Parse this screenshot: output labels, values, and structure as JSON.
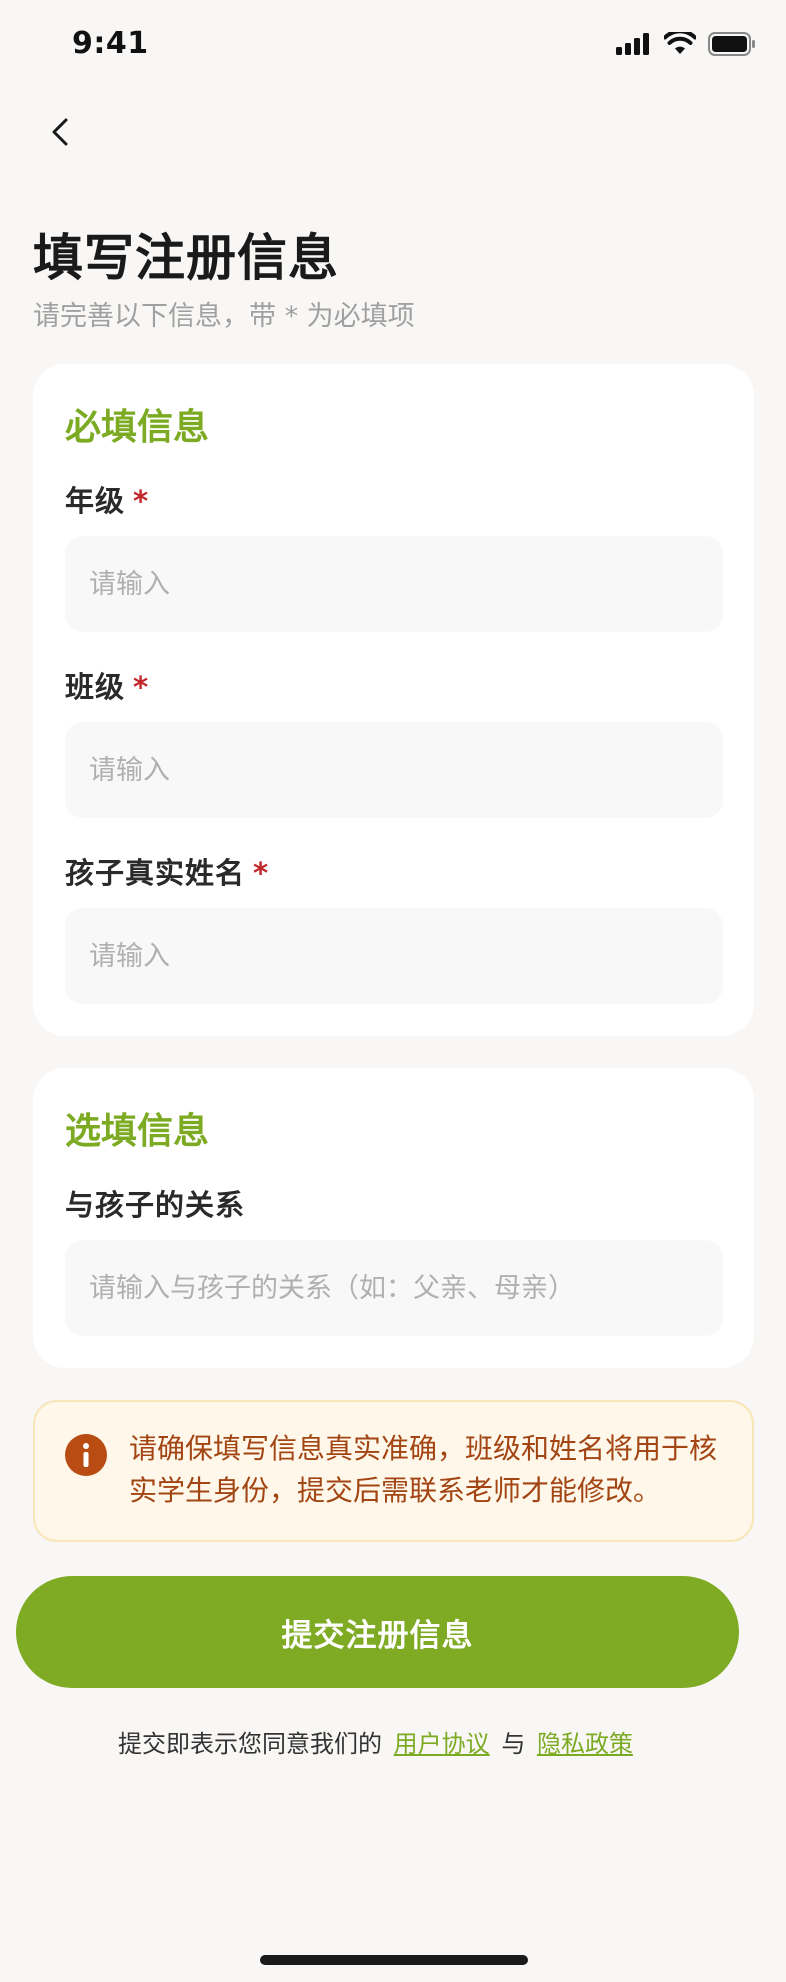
{
  "status_bar": {
    "time": "9:41"
  },
  "header": {
    "title": "填写注册信息",
    "subtitle": "请完善以下信息，带 * 为必填项"
  },
  "required_section": {
    "title": "必填信息",
    "star": "*",
    "fields": [
      {
        "label": "年级",
        "placeholder": "请输入",
        "value": ""
      },
      {
        "label": "班级",
        "placeholder": "请输入",
        "value": ""
      },
      {
        "label": "孩子真实姓名",
        "placeholder": "请输入",
        "value": ""
      }
    ]
  },
  "optional_section": {
    "title": "选填信息",
    "fields": [
      {
        "label": "与孩子的关系",
        "placeholder": "请输入与孩子的关系（如：父亲、母亲）",
        "value": ""
      }
    ]
  },
  "notice": {
    "text": "请确保填写信息真实准确，班级和姓名将用于核实学生身份，提交后需联系老师才能修改。"
  },
  "submit": {
    "label": "提交注册信息"
  },
  "agreement": {
    "prefix": "提交即表示您同意我们的",
    "terms_link": "用户协议",
    "connector": "与",
    "privacy_link": "隐私政策"
  },
  "colors": {
    "accent": "#7fab24",
    "required_star": "#c0262a",
    "notice_text": "#a24513",
    "notice_bg": "#fff8ea"
  }
}
